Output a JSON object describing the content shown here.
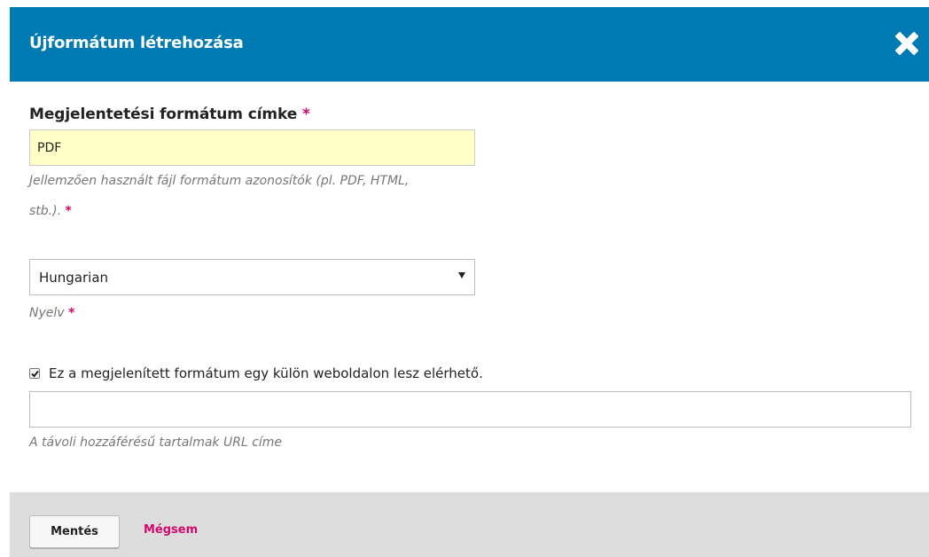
{
  "modal": {
    "title": "Újformátum létrehozása",
    "close_icon": "close-icon"
  },
  "format_label": {
    "label": "Megjelentetési formátum címke",
    "required_mark": "*",
    "value": "PDF",
    "help_line1": "Jellemzően használt fájl formátum azonosítók (pl. PDF, HTML,",
    "help_line2": "stb.).",
    "help_required_mark": "*"
  },
  "language": {
    "selected": "Hungarian",
    "help": "Nyelv",
    "help_required_mark": "*"
  },
  "remote": {
    "checkbox_checked": true,
    "checkbox_label": "Ez a megjelenített formátum egy külön weboldalon lesz elérhető.",
    "url_value": "",
    "help": "A távoli hozzáférésű tartalmak URL címe"
  },
  "footer": {
    "save_label": "Mentés",
    "cancel_label": "Mégsem"
  },
  "colors": {
    "header_bg": "#007ab2",
    "required": "#d00a6c",
    "highlight_input": "#ffffc7",
    "footer_bg": "#dddddd"
  }
}
